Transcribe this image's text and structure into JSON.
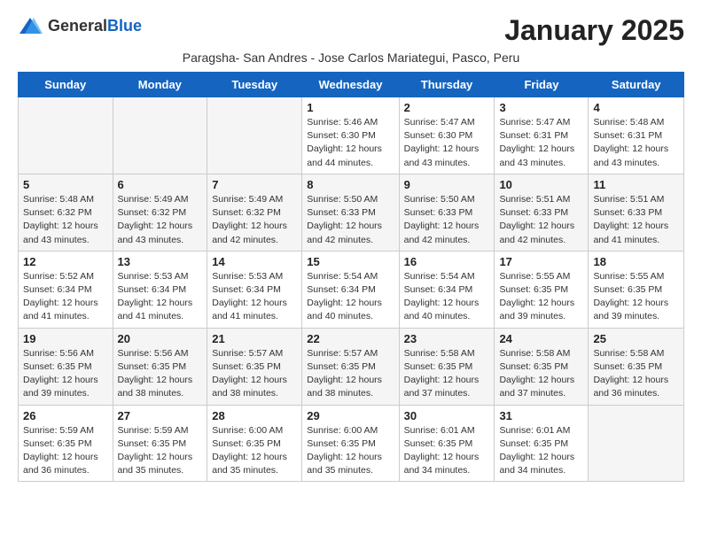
{
  "header": {
    "logo_general": "General",
    "logo_blue": "Blue",
    "month_title": "January 2025",
    "subtitle": "Paragsha- San Andres - Jose Carlos Mariategui, Pasco, Peru"
  },
  "days_of_week": [
    "Sunday",
    "Monday",
    "Tuesday",
    "Wednesday",
    "Thursday",
    "Friday",
    "Saturday"
  ],
  "weeks": [
    {
      "days": [
        {
          "num": "",
          "empty": true
        },
        {
          "num": "",
          "empty": true
        },
        {
          "num": "",
          "empty": true
        },
        {
          "num": "1",
          "sunrise": "5:46 AM",
          "sunset": "6:30 PM",
          "daylight": "12 hours and 44 minutes."
        },
        {
          "num": "2",
          "sunrise": "5:47 AM",
          "sunset": "6:30 PM",
          "daylight": "12 hours and 43 minutes."
        },
        {
          "num": "3",
          "sunrise": "5:47 AM",
          "sunset": "6:31 PM",
          "daylight": "12 hours and 43 minutes."
        },
        {
          "num": "4",
          "sunrise": "5:48 AM",
          "sunset": "6:31 PM",
          "daylight": "12 hours and 43 minutes."
        }
      ]
    },
    {
      "days": [
        {
          "num": "5",
          "sunrise": "5:48 AM",
          "sunset": "6:32 PM",
          "daylight": "12 hours and 43 minutes."
        },
        {
          "num": "6",
          "sunrise": "5:49 AM",
          "sunset": "6:32 PM",
          "daylight": "12 hours and 43 minutes."
        },
        {
          "num": "7",
          "sunrise": "5:49 AM",
          "sunset": "6:32 PM",
          "daylight": "12 hours and 42 minutes."
        },
        {
          "num": "8",
          "sunrise": "5:50 AM",
          "sunset": "6:33 PM",
          "daylight": "12 hours and 42 minutes."
        },
        {
          "num": "9",
          "sunrise": "5:50 AM",
          "sunset": "6:33 PM",
          "daylight": "12 hours and 42 minutes."
        },
        {
          "num": "10",
          "sunrise": "5:51 AM",
          "sunset": "6:33 PM",
          "daylight": "12 hours and 42 minutes."
        },
        {
          "num": "11",
          "sunrise": "5:51 AM",
          "sunset": "6:33 PM",
          "daylight": "12 hours and 41 minutes."
        }
      ]
    },
    {
      "days": [
        {
          "num": "12",
          "sunrise": "5:52 AM",
          "sunset": "6:34 PM",
          "daylight": "12 hours and 41 minutes."
        },
        {
          "num": "13",
          "sunrise": "5:53 AM",
          "sunset": "6:34 PM",
          "daylight": "12 hours and 41 minutes."
        },
        {
          "num": "14",
          "sunrise": "5:53 AM",
          "sunset": "6:34 PM",
          "daylight": "12 hours and 41 minutes."
        },
        {
          "num": "15",
          "sunrise": "5:54 AM",
          "sunset": "6:34 PM",
          "daylight": "12 hours and 40 minutes."
        },
        {
          "num": "16",
          "sunrise": "5:54 AM",
          "sunset": "6:34 PM",
          "daylight": "12 hours and 40 minutes."
        },
        {
          "num": "17",
          "sunrise": "5:55 AM",
          "sunset": "6:35 PM",
          "daylight": "12 hours and 39 minutes."
        },
        {
          "num": "18",
          "sunrise": "5:55 AM",
          "sunset": "6:35 PM",
          "daylight": "12 hours and 39 minutes."
        }
      ]
    },
    {
      "days": [
        {
          "num": "19",
          "sunrise": "5:56 AM",
          "sunset": "6:35 PM",
          "daylight": "12 hours and 39 minutes."
        },
        {
          "num": "20",
          "sunrise": "5:56 AM",
          "sunset": "6:35 PM",
          "daylight": "12 hours and 38 minutes."
        },
        {
          "num": "21",
          "sunrise": "5:57 AM",
          "sunset": "6:35 PM",
          "daylight": "12 hours and 38 minutes."
        },
        {
          "num": "22",
          "sunrise": "5:57 AM",
          "sunset": "6:35 PM",
          "daylight": "12 hours and 38 minutes."
        },
        {
          "num": "23",
          "sunrise": "5:58 AM",
          "sunset": "6:35 PM",
          "daylight": "12 hours and 37 minutes."
        },
        {
          "num": "24",
          "sunrise": "5:58 AM",
          "sunset": "6:35 PM",
          "daylight": "12 hours and 37 minutes."
        },
        {
          "num": "25",
          "sunrise": "5:58 AM",
          "sunset": "6:35 PM",
          "daylight": "12 hours and 36 minutes."
        }
      ]
    },
    {
      "days": [
        {
          "num": "26",
          "sunrise": "5:59 AM",
          "sunset": "6:35 PM",
          "daylight": "12 hours and 36 minutes."
        },
        {
          "num": "27",
          "sunrise": "5:59 AM",
          "sunset": "6:35 PM",
          "daylight": "12 hours and 35 minutes."
        },
        {
          "num": "28",
          "sunrise": "6:00 AM",
          "sunset": "6:35 PM",
          "daylight": "12 hours and 35 minutes."
        },
        {
          "num": "29",
          "sunrise": "6:00 AM",
          "sunset": "6:35 PM",
          "daylight": "12 hours and 35 minutes."
        },
        {
          "num": "30",
          "sunrise": "6:01 AM",
          "sunset": "6:35 PM",
          "daylight": "12 hours and 34 minutes."
        },
        {
          "num": "31",
          "sunrise": "6:01 AM",
          "sunset": "6:35 PM",
          "daylight": "12 hours and 34 minutes."
        },
        {
          "num": "",
          "empty": true
        }
      ]
    }
  ]
}
